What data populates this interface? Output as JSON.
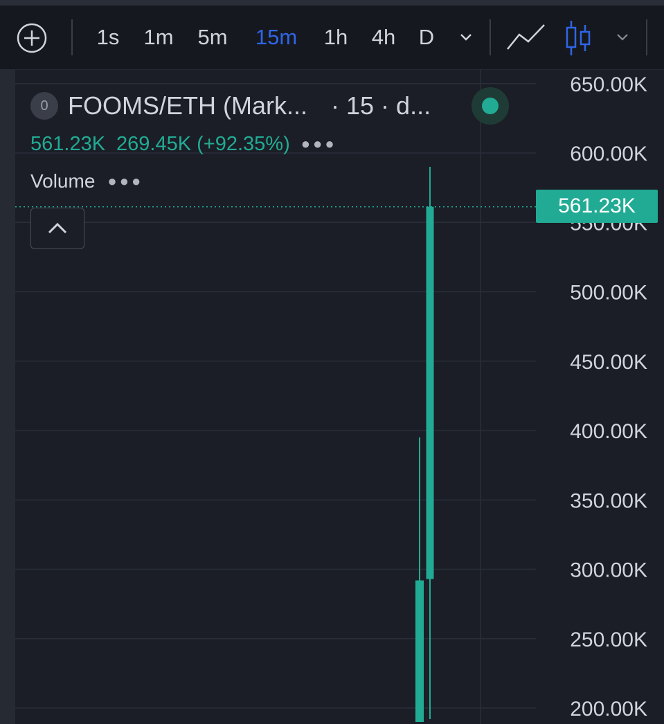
{
  "toolbar": {
    "add_icon": "plus-circle-icon",
    "intervals": [
      "1s",
      "1m",
      "5m",
      "15m",
      "1h",
      "4h",
      "D"
    ],
    "active_interval": "15m",
    "chevron_icon": "chevron-down-icon",
    "line_chart_icon": "line-chart-icon",
    "candles_icon": "candlestick-icon",
    "candles_chevron_icon": "chevron-down-icon"
  },
  "legend": {
    "badge": "0",
    "symbol": "FOOMS/ETH (Mark...",
    "interval": "· 15 · d...",
    "close": "561.23K",
    "change": "269.45K (+92.35%)",
    "volume_label": "Volume",
    "more_icon": "more-dots-icon",
    "live_icon": "live-status-dot-icon",
    "collapse_icon": "chevron-up-icon"
  },
  "colors": {
    "up": "#22ab94",
    "background": "#1b1e26",
    "grid": "#2a2e39",
    "text": "#d1d4dc",
    "accent": "#2f66e8"
  },
  "chart_data": {
    "type": "candlestick",
    "ylim": [
      190000,
      660000
    ],
    "y_ticks": [
      "650.00K",
      "600.00K",
      "550.00K",
      "500.00K",
      "450.00K",
      "400.00K",
      "350.00K",
      "300.00K",
      "250.00K",
      "200.00K"
    ],
    "y_tick_values": [
      650000,
      600000,
      550000,
      500000,
      450000,
      400000,
      350000,
      300000,
      250000,
      200000
    ],
    "last_price": 561230,
    "last_price_label": "561.23K",
    "candles": [
      {
        "open": 190000,
        "close": 292000,
        "high": 395000,
        "low": 190000
      },
      {
        "open": 293000,
        "close": 561230,
        "high": 590000,
        "low": 192000
      }
    ]
  }
}
